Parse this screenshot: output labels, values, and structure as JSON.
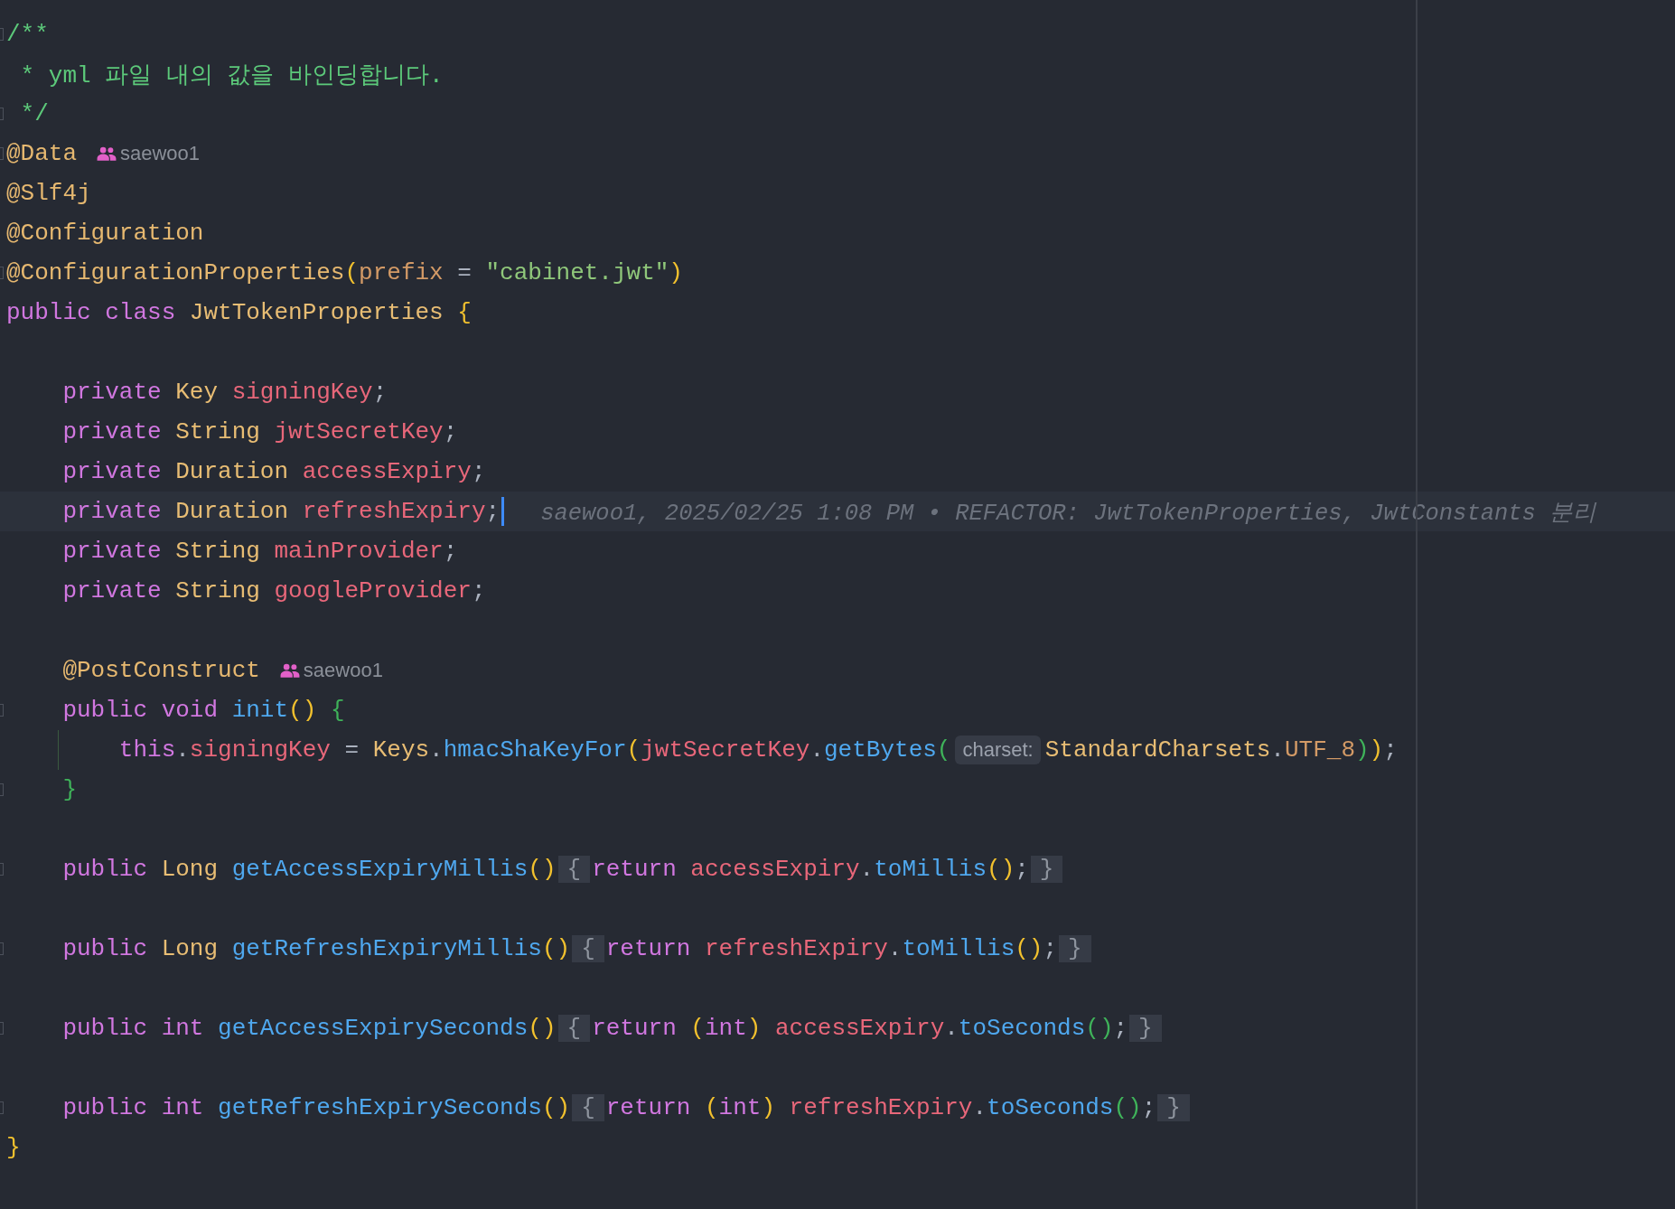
{
  "lines": [
    {
      "current": false,
      "fold": true,
      "code": [
        {
          "kind": "comment",
          "text": "/**"
        }
      ]
    },
    {
      "current": false,
      "fold": false,
      "code": [
        {
          "kind": "comment",
          "text": " * yml 파일 내의 값을 바인딩합니다."
        }
      ]
    },
    {
      "current": false,
      "fold": true,
      "code": [
        {
          "kind": "comment",
          "text": " */"
        }
      ]
    },
    {
      "current": false,
      "fold": true,
      "code": [
        {
          "kind": "annotation",
          "text": "@Data"
        }
      ],
      "author": "saewoo1"
    },
    {
      "current": false,
      "fold": false,
      "code": [
        {
          "kind": "annotation",
          "text": "@Slf4j"
        }
      ]
    },
    {
      "current": false,
      "fold": false,
      "code": [
        {
          "kind": "annotation",
          "text": "@Configuration"
        }
      ]
    },
    {
      "current": false,
      "fold": true,
      "code": [
        {
          "kind": "annotation",
          "text": "@ConfigurationProperties"
        },
        {
          "kind": "paren",
          "text": "("
        },
        {
          "kind": "param",
          "text": "prefix"
        },
        {
          "kind": "plain",
          "text": " = "
        },
        {
          "kind": "string",
          "text": "\"cabinet.jwt\""
        },
        {
          "kind": "paren",
          "text": ")"
        }
      ]
    },
    {
      "current": false,
      "fold": false,
      "code": [
        {
          "kind": "keyword",
          "text": "public class "
        },
        {
          "kind": "type",
          "text": "JwtTokenProperties "
        },
        {
          "kind": "paren",
          "text": "{"
        }
      ]
    },
    {
      "current": false,
      "fold": false
    },
    {
      "current": false,
      "fold": false,
      "code": [
        {
          "kind": "keyword",
          "text": "    private "
        },
        {
          "kind": "type",
          "text": "Key "
        },
        {
          "kind": "field",
          "text": "signingKey"
        },
        {
          "kind": "plain",
          "text": ";"
        }
      ]
    },
    {
      "current": false,
      "fold": false,
      "code": [
        {
          "kind": "keyword",
          "text": "    private "
        },
        {
          "kind": "type",
          "text": "String "
        },
        {
          "kind": "field",
          "text": "jwtSecretKey"
        },
        {
          "kind": "plain",
          "text": ";"
        }
      ]
    },
    {
      "current": false,
      "fold": false,
      "code": [
        {
          "kind": "keyword",
          "text": "    private "
        },
        {
          "kind": "type",
          "text": "Duration "
        },
        {
          "kind": "field",
          "text": "accessExpiry"
        },
        {
          "kind": "plain",
          "text": ";"
        }
      ]
    },
    {
      "current": true,
      "fold": false,
      "code": [
        {
          "kind": "keyword",
          "text": "    private "
        },
        {
          "kind": "type",
          "text": "Duration "
        },
        {
          "kind": "field",
          "text": "refreshExpiry"
        },
        {
          "kind": "plain",
          "text": ";"
        }
      ],
      "blame": "saewoo1, 2025/02/25 1:08 PM • REFACTOR: JwtTokenProperties, JwtConstants 분리"
    },
    {
      "current": false,
      "fold": false,
      "code": [
        {
          "kind": "keyword",
          "text": "    private "
        },
        {
          "kind": "type",
          "text": "String "
        },
        {
          "kind": "field",
          "text": "mainProvider"
        },
        {
          "kind": "plain",
          "text": ";"
        }
      ]
    },
    {
      "current": false,
      "fold": false,
      "code": [
        {
          "kind": "keyword",
          "text": "    private "
        },
        {
          "kind": "type",
          "text": "String "
        },
        {
          "kind": "field",
          "text": "googleProvider"
        },
        {
          "kind": "plain",
          "text": ";"
        }
      ]
    },
    {
      "current": false,
      "fold": false
    },
    {
      "current": false,
      "fold": false,
      "code": [
        {
          "kind": "annotation",
          "text": "    @PostConstruct"
        }
      ],
      "author": "saewoo1"
    },
    {
      "current": false,
      "fold": true,
      "code": [
        {
          "kind": "keyword",
          "text": "    public void "
        },
        {
          "kind": "method",
          "text": "init"
        },
        {
          "kind": "paren",
          "text": "() "
        },
        {
          "kind": "nestedparen",
          "text": "{"
        }
      ]
    },
    {
      "current": false,
      "fold": false,
      "guide": true,
      "code": [
        {
          "kind": "keyword",
          "text": "        this"
        },
        {
          "kind": "plain",
          "text": "."
        },
        {
          "kind": "field",
          "text": "signingKey"
        },
        {
          "kind": "plain",
          "text": " = "
        },
        {
          "kind": "type",
          "text": "Keys"
        },
        {
          "kind": "plain",
          "text": "."
        },
        {
          "kind": "method",
          "text": "hmacShaKeyFor"
        },
        {
          "kind": "paren",
          "text": "("
        },
        {
          "kind": "field",
          "text": "jwtSecretKey"
        },
        {
          "kind": "plain",
          "text": "."
        },
        {
          "kind": "method",
          "text": "getBytes"
        },
        {
          "kind": "nestedparen",
          "text": "("
        },
        {
          "kind": "hint",
          "text": "charset:"
        },
        {
          "kind": "type",
          "text": "StandardCharsets"
        },
        {
          "kind": "plain",
          "text": "."
        },
        {
          "kind": "constant",
          "text": "UTF_8"
        },
        {
          "kind": "nestedparen",
          "text": ")"
        },
        {
          "kind": "paren",
          "text": ")"
        },
        {
          "kind": "plain",
          "text": ";"
        }
      ]
    },
    {
      "current": false,
      "fold": true,
      "code": [
        {
          "kind": "nestedparen",
          "text": "    }"
        }
      ]
    },
    {
      "current": false,
      "fold": false
    },
    {
      "current": false,
      "fold": true,
      "code": [
        {
          "kind": "keyword",
          "text": "    public "
        },
        {
          "kind": "type",
          "text": "Long "
        },
        {
          "kind": "method",
          "text": "getAccessExpiryMillis"
        },
        {
          "kind": "paren",
          "text": "()"
        },
        {
          "kind": "folded",
          "text": "{"
        },
        {
          "kind": "keyword",
          "text": "return "
        },
        {
          "kind": "field",
          "text": "accessExpiry"
        },
        {
          "kind": "plain",
          "text": "."
        },
        {
          "kind": "method",
          "text": "toMillis"
        },
        {
          "kind": "paren",
          "text": "()"
        },
        {
          "kind": "plain",
          "text": ";"
        },
        {
          "kind": "folded",
          "text": "}"
        }
      ]
    },
    {
      "current": false,
      "fold": false
    },
    {
      "current": false,
      "fold": true,
      "code": [
        {
          "kind": "keyword",
          "text": "    public "
        },
        {
          "kind": "type",
          "text": "Long "
        },
        {
          "kind": "method",
          "text": "getRefreshExpiryMillis"
        },
        {
          "kind": "paren",
          "text": "()"
        },
        {
          "kind": "folded",
          "text": "{"
        },
        {
          "kind": "keyword",
          "text": "return "
        },
        {
          "kind": "field",
          "text": "refreshExpiry"
        },
        {
          "kind": "plain",
          "text": "."
        },
        {
          "kind": "method",
          "text": "toMillis"
        },
        {
          "kind": "paren",
          "text": "()"
        },
        {
          "kind": "plain",
          "text": ";"
        },
        {
          "kind": "folded",
          "text": "}"
        }
      ]
    },
    {
      "current": false,
      "fold": false
    },
    {
      "current": false,
      "fold": true,
      "code": [
        {
          "kind": "keyword",
          "text": "    public int "
        },
        {
          "kind": "method",
          "text": "getAccessExpirySeconds"
        },
        {
          "kind": "paren",
          "text": "()"
        },
        {
          "kind": "folded",
          "text": "{"
        },
        {
          "kind": "keyword",
          "text": "return "
        },
        {
          "kind": "paren",
          "text": "("
        },
        {
          "kind": "keyword",
          "text": "int"
        },
        {
          "kind": "paren",
          "text": ") "
        },
        {
          "kind": "field",
          "text": "accessExpiry"
        },
        {
          "kind": "plain",
          "text": "."
        },
        {
          "kind": "method",
          "text": "toSeconds"
        },
        {
          "kind": "nestedparen",
          "text": "()"
        },
        {
          "kind": "plain",
          "text": ";"
        },
        {
          "kind": "folded",
          "text": "}"
        }
      ]
    },
    {
      "current": false,
      "fold": false
    },
    {
      "current": false,
      "fold": true,
      "code": [
        {
          "kind": "keyword",
          "text": "    public int "
        },
        {
          "kind": "method",
          "text": "getRefreshExpirySeconds"
        },
        {
          "kind": "paren",
          "text": "()"
        },
        {
          "kind": "folded",
          "text": "{"
        },
        {
          "kind": "keyword",
          "text": "return "
        },
        {
          "kind": "paren",
          "text": "("
        },
        {
          "kind": "keyword",
          "text": "int"
        },
        {
          "kind": "paren",
          "text": ") "
        },
        {
          "kind": "field",
          "text": "refreshExpiry"
        },
        {
          "kind": "plain",
          "text": "."
        },
        {
          "kind": "method",
          "text": "toSeconds"
        },
        {
          "kind": "nestedparen",
          "text": "()"
        },
        {
          "kind": "plain",
          "text": ";"
        },
        {
          "kind": "folded",
          "text": "}"
        }
      ]
    },
    {
      "current": false,
      "fold": false,
      "code": [
        {
          "kind": "paren",
          "text": "}"
        }
      ]
    }
  ]
}
